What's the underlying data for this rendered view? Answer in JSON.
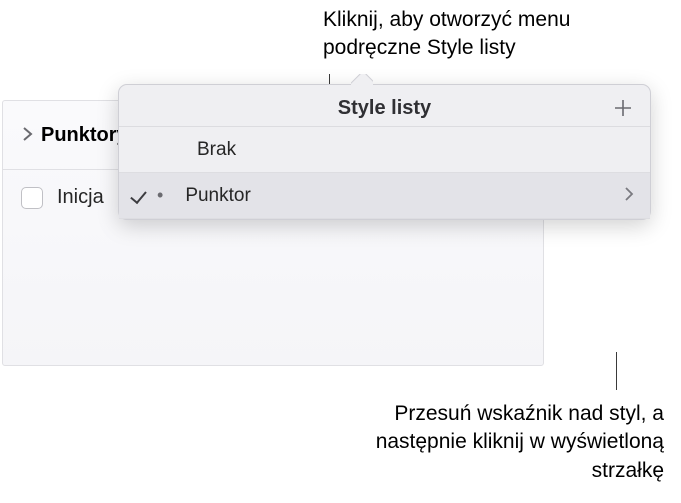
{
  "annotations": {
    "top": "Kliknij, aby otworzyć menu podręczne Style listy",
    "bottom": "Przesuń wskaźnik nad styl, a następnie kliknij w wyświetloną strzałkę"
  },
  "panel": {
    "section_label": "Punktory i listy",
    "dropdown_value": "Punktor",
    "option_label": "Inicja"
  },
  "popover": {
    "title": "Style listy",
    "items": {
      "0": {
        "label": "Brak"
      },
      "1": {
        "label": "Punktor"
      }
    }
  }
}
